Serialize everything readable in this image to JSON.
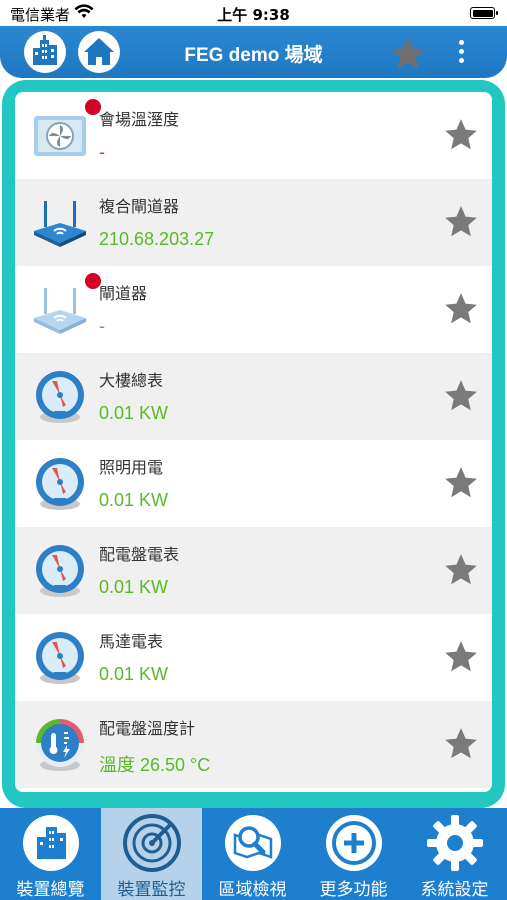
{
  "status_bar": {
    "carrier": "電信業者",
    "time": "上午 9:38"
  },
  "header": {
    "title": "FEG demo 場域"
  },
  "devices": [
    {
      "name": "會場溫溼度",
      "value": "-",
      "value_color": "red",
      "icon": "aircon-icon",
      "offline": true
    },
    {
      "name": "複合閘道器",
      "value": "210.68.203.27",
      "value_color": "green",
      "icon": "router-icon",
      "offline": false
    },
    {
      "name": "閘道器",
      "value": "-",
      "value_color": "green",
      "icon": "router-icon",
      "offline": true
    },
    {
      "name": "大樓總表",
      "value": "0.01 KW",
      "value_color": "green",
      "icon": "meter-icon",
      "offline": false
    },
    {
      "name": "照明用電",
      "value": "0.01 KW",
      "value_color": "green",
      "icon": "meter-icon",
      "offline": false
    },
    {
      "name": "配電盤電表",
      "value": "0.01 KW",
      "value_color": "green",
      "icon": "meter-icon",
      "offline": false
    },
    {
      "name": "馬達電表",
      "value": "0.01 KW",
      "value_color": "green",
      "icon": "meter-icon",
      "offline": false
    },
    {
      "name": "配電盤溫度計",
      "value": "溫度 26.50 °C",
      "value_color": "green",
      "icon": "thermometer-icon",
      "offline": false
    }
  ],
  "tabs": [
    {
      "label": "裝置總覽",
      "icon": "building-icon",
      "active": false
    },
    {
      "label": "裝置監控",
      "icon": "radar-icon",
      "active": true
    },
    {
      "label": "區域檢視",
      "icon": "map-search-icon",
      "active": false
    },
    {
      "label": "更多功能",
      "icon": "plus-icon",
      "active": false
    },
    {
      "label": "系統設定",
      "icon": "gear-icon",
      "active": false
    }
  ],
  "colors": {
    "header": "#1f77c2",
    "panel": "#22c7c1",
    "value_green": "#5ab82a",
    "value_red": "#d9342b",
    "offline_dot": "#d40026",
    "star": "#7a7a7a"
  }
}
